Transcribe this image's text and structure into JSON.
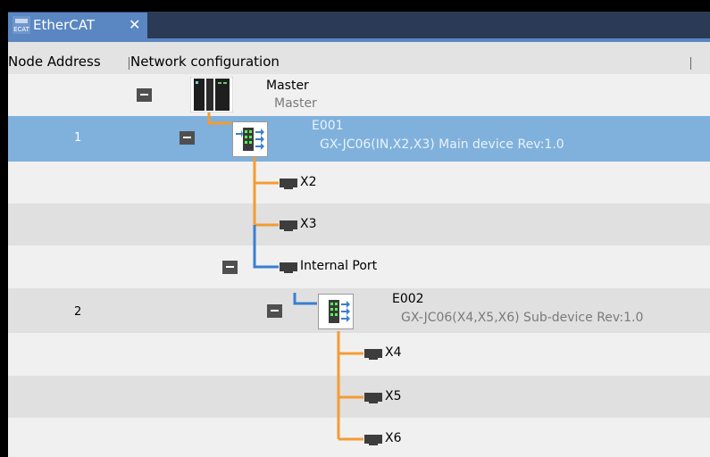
{
  "tab": {
    "label": "EtherCAT",
    "close": "✕"
  },
  "columns": {
    "node_address": "Node Address",
    "network_configuration": "Network configuration"
  },
  "master": {
    "name": "Master",
    "model": "Master"
  },
  "e001": {
    "node_address": "1",
    "name": "E001",
    "model": "GX-JC06(IN,X2,X3) Main device Rev:1.0"
  },
  "ports": {
    "x2": "X2",
    "x3": "X3",
    "internal": "Internal Port",
    "x4": "X4",
    "x5": "X5",
    "x6": "X6"
  },
  "e002": {
    "node_address": "2",
    "name": "E002",
    "model": "GX-JC06(X4,X5,X6) Sub-device Rev:1.0"
  },
  "colors": {
    "orange_line": "#f39c33",
    "blue_line": "#3a7fd0",
    "selection": "#7fb1dc",
    "tab": "#5a86c2"
  }
}
